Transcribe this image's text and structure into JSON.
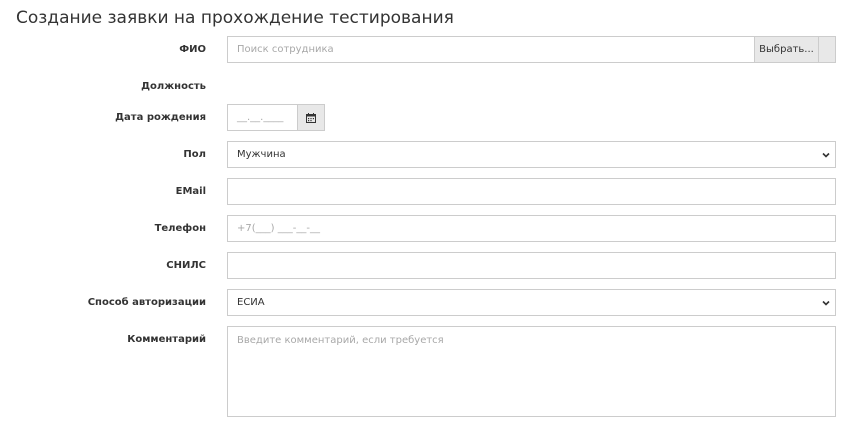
{
  "page": {
    "title": "Создание заявки на прохождение тестирования"
  },
  "form": {
    "fio": {
      "label": "ФИО",
      "placeholder": "Поиск сотрудника",
      "button_label": "Выбрать..."
    },
    "position": {
      "label": "Должность",
      "value": ""
    },
    "birth_date": {
      "label": "Дата рождения",
      "mask": "__.__.____",
      "icon": "calendar-icon"
    },
    "gender": {
      "label": "Пол",
      "value": "Мужчина"
    },
    "email": {
      "label": "EMail",
      "value": ""
    },
    "phone": {
      "label": "Телефон",
      "mask": "+7(___) ___-__-__"
    },
    "snils": {
      "label": "СНИЛС",
      "value": ""
    },
    "auth_method": {
      "label": "Способ авторизации",
      "value": "ЕСИА"
    },
    "comment": {
      "label": "Комментарий",
      "placeholder": "Введите комментарий, если требуется"
    }
  }
}
